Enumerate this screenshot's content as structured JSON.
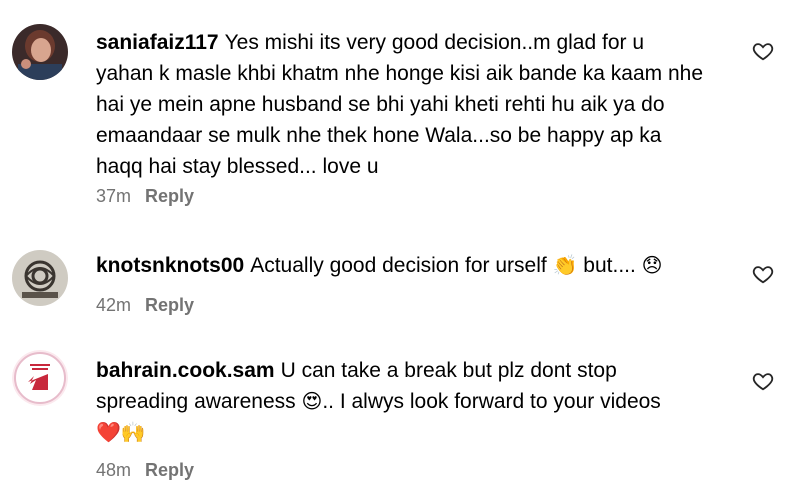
{
  "comments": [
    {
      "username": "saniafaiz117",
      "text": "Yes mishi its very good decision..m glad for u yahan k masle khbi khatm nhe honge kisi aik bande ka kaam nhe hai ye mein apne husband se bhi yahi kheti rehti hu aik ya do emaandaar se mulk nhe thek hone Wala...so be happy ap ka haqq hai stay blessed... love u",
      "time": "37m",
      "reply": "Reply"
    },
    {
      "username": "knotsnknots00",
      "text": "Actually good decision for urself",
      "emoji1": "👏",
      "text2": "but....",
      "emoji2": "😞",
      "time": "42m",
      "reply": "Reply"
    },
    {
      "username": "bahrain.cook.sam",
      "text": "U can take a break but plz dont stop spreading awareness",
      "emoji1": "😍",
      "text2": ".. I alwys look forward to your videos",
      "emoji2": "❤️🙌",
      "time": "48m",
      "reply": "Reply"
    }
  ],
  "icons": {
    "like": "heart-outline-icon"
  },
  "colors": {
    "meta": "#737373",
    "text": "#000000"
  }
}
